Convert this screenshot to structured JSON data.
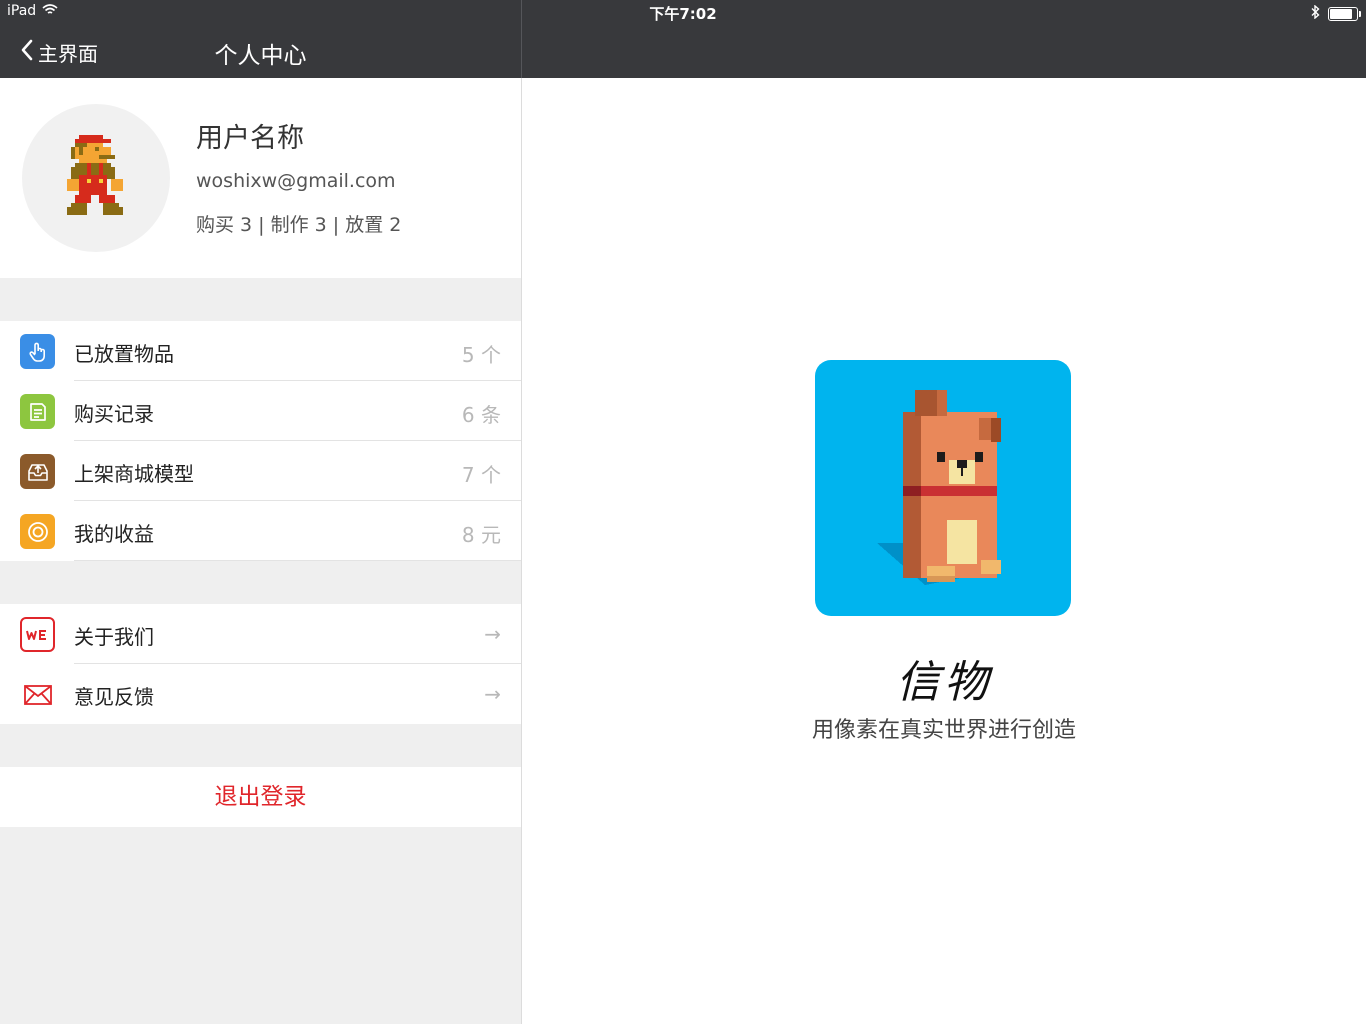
{
  "status": {
    "device": "iPad",
    "time": "下午7:02",
    "battery_level": 0.85
  },
  "nav": {
    "back_label": "主界面",
    "title": "个人中心"
  },
  "profile": {
    "name": "用户名称",
    "email": "woshixw@gmail.com",
    "stats": "购买 3 | 制作 3 | 放置 2"
  },
  "menu": {
    "items": [
      {
        "label": "已放置物品",
        "value": "5 个",
        "icon": "hand-pointer-icon",
        "color": "#3a8ee6"
      },
      {
        "label": "购买记录",
        "value": "6 条",
        "icon": "note-icon",
        "color": "#8dc63f"
      },
      {
        "label": "上架商城模型",
        "value": "7 个",
        "icon": "inbox-upload-icon",
        "color": "#8b5a2b"
      },
      {
        "label": "我的收益",
        "value": "8 元",
        "icon": "coin-icon",
        "color": "#f5a623"
      }
    ],
    "more": [
      {
        "label": "关于我们",
        "value": "→",
        "icon": "we-logo-icon",
        "color": "#e0262b"
      },
      {
        "label": "意见反馈",
        "value": "→",
        "icon": "mail-icon",
        "color": "#e0262b"
      }
    ]
  },
  "logout_label": "退出登录",
  "app": {
    "name": "信物",
    "slogan": "用像素在真实世界进行创造",
    "icon_bg": "#00b4ee"
  },
  "colors": {
    "nav_bg": "#38393c",
    "accent_red": "#e0262b",
    "panel_bg": "#efefef"
  }
}
